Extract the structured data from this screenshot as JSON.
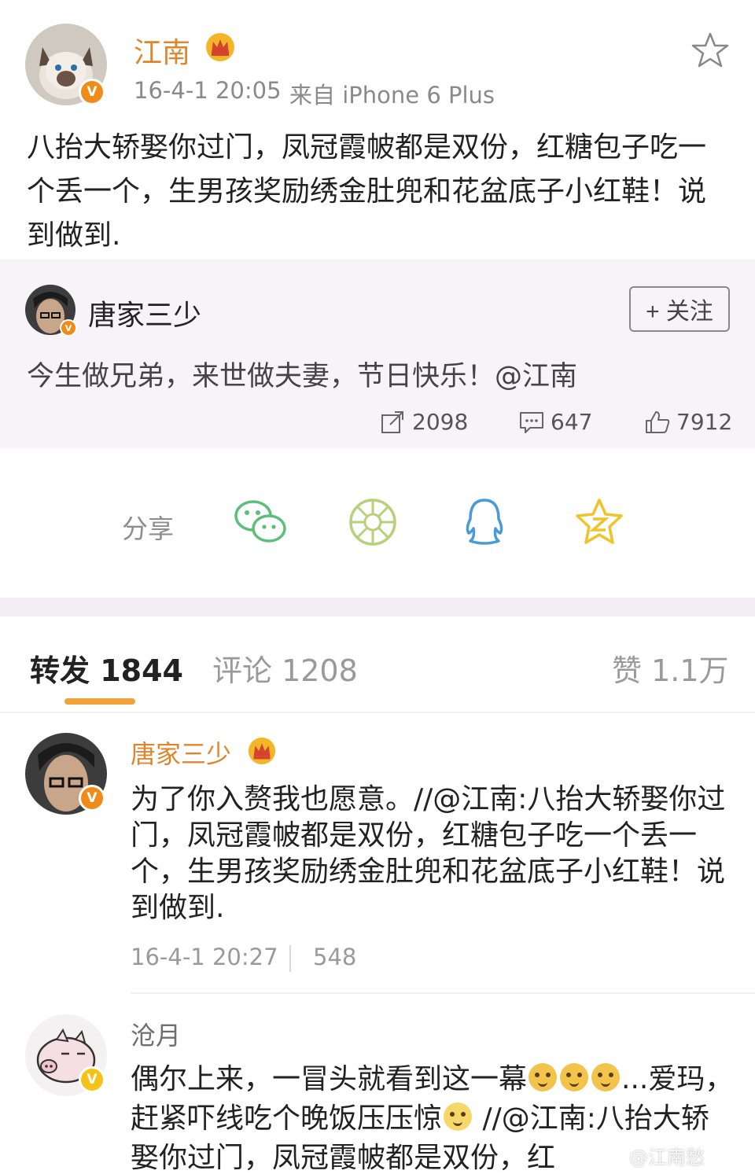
{
  "post": {
    "author": "江南",
    "time": "16-4-1 20:05",
    "source": "来自 iPhone 6 Plus",
    "text": "八抬大轿娶你过门，凤冠霞帔都是双份，红糖包子吃一个丢一个，生男孩奖励绣金肚兜和花盆底子小红鞋！说到做到.",
    "badge": "V"
  },
  "repost": {
    "author": "唐家三少",
    "follow_label": "+ 关注",
    "text": "今生做兄弟，来世做夫妻，节日快乐！@江南",
    "reposts": "2098",
    "comments": "647",
    "likes": "7912"
  },
  "share": {
    "label": "分享",
    "targets": [
      "wechat-icon",
      "moments-icon",
      "qq-icon",
      "qzone-icon"
    ]
  },
  "tabs": {
    "repost": "转发 1844",
    "comment": "评论 1208",
    "like": "赞 1.1万"
  },
  "comments": [
    {
      "author": "唐家三少",
      "text": "为了你入赘我也愿意。//@江南:八抬大轿娶你过门，凤冠霞帔都是双份，红糖包子吃一个丢一个，生男孩奖励绣金肚兜和花盆底子小红鞋！说到做到.",
      "time": "16-4-1 20:27",
      "count": "548"
    },
    {
      "author": "沧月",
      "text_a": "偶尔上来，一冒头就看到这一幕",
      "text_b": "...爱玛，赶紧吓线吃个晚饭压压惊",
      "text_c": " //@江南:八抬大轿娶你过门，凤冠霞帔都是双份，红"
    }
  ],
  "watermark": "@江南愁",
  "colors": {
    "username": "#e0852c",
    "accent_underline": "#f1a33a",
    "vip_badge": "#f08a18",
    "repost_bg": "#f7f3f8"
  }
}
